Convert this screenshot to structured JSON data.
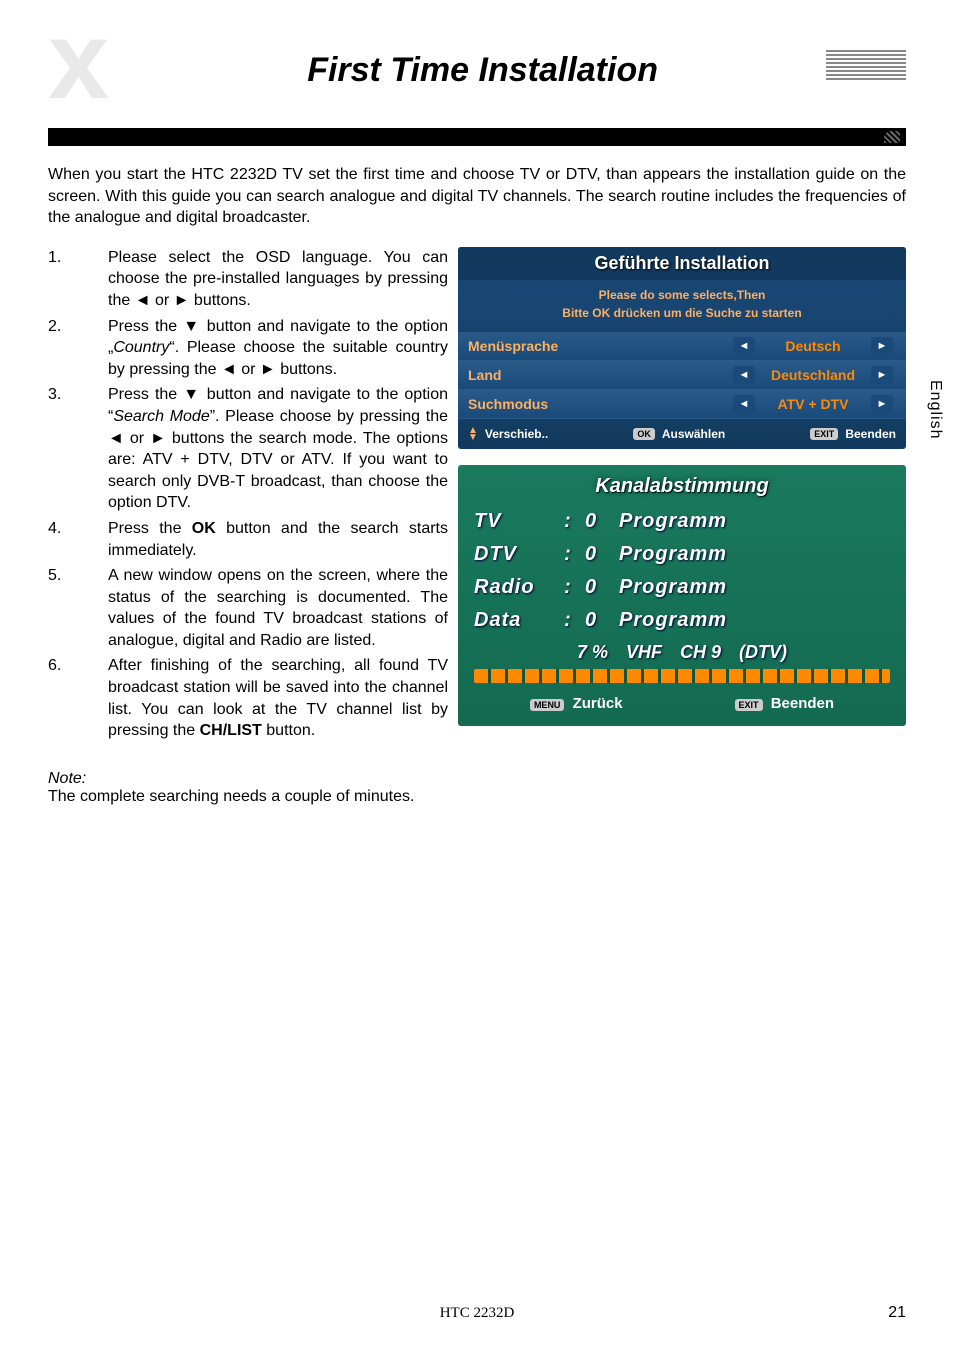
{
  "header": {
    "title": "First Time Installation",
    "logo_letter": "x"
  },
  "side_tab": "English",
  "intro": "When you start the HTC 2232D TV set the first time and choose TV or DTV, than appears the installation guide on the screen. With this guide you can search analogue and digital TV channels. The search routine includes the frequencies of the analogue and digital broadcaster.",
  "steps": [
    {
      "num": "1.",
      "text": "Please select the OSD language. You can choose the pre-installed languages by pressing the ◄ or ► buttons."
    },
    {
      "num": "2.",
      "text_html": "Press the ▼ button and navigate to the option „<i>Country</i>“. Please choose the suitable country by pressing the ◄ or ► buttons."
    },
    {
      "num": "3.",
      "text_html": "Press the ▼ button and navigate to the option “<i>Search Mode</i>”. Please choose by pressing the ◄ or ► buttons the search mode. The options are: ATV + DTV, DTV or ATV. If you want to search only DVB-T broadcast, than choose the option DTV."
    },
    {
      "num": "4.",
      "text_html": "Press the <b>OK</b> button and the search starts immediately."
    },
    {
      "num": "5.",
      "text": "A new window opens on the screen, where the status of the searching is documented. The values of the found TV broadcast stations of analogue, digital and Radio are listed."
    },
    {
      "num": "6.",
      "text_html": "After finishing of the searching, all found TV broadcast station will be saved into the channel list. You can look at the TV channel list by pressing the <b>CH/LIST</b> button."
    }
  ],
  "osd1": {
    "title": "Geführte Installation",
    "sub1": "Please do some selects,Then",
    "sub2": "Bitte OK drücken um die Suche zu starten",
    "rows": [
      {
        "label": "Menüsprache",
        "value": "Deutsch"
      },
      {
        "label": "Land",
        "value": "Deutschland"
      },
      {
        "label": "Suchmodus",
        "value": "ATV + DTV"
      }
    ],
    "footer": {
      "move": "Verschieb..",
      "ok_key": "OK",
      "ok_label": "Auswählen",
      "exit_key": "EXIT",
      "exit_label": "Beenden"
    }
  },
  "osd2": {
    "title": "Kanalabstimmung",
    "rows": [
      {
        "name": "TV",
        "count": "0",
        "label": "Programm"
      },
      {
        "name": "DTV",
        "count": "0",
        "label": "Programm"
      },
      {
        "name": "Radio",
        "count": "0",
        "label": "Programm"
      },
      {
        "name": "Data",
        "count": "0",
        "label": "Programm"
      }
    ],
    "status": {
      "percent": "7 %",
      "band": "VHF",
      "ch": "CH 9",
      "mode": "(DTV)"
    },
    "footer": {
      "menu_key": "MENU",
      "menu_label": "Zurück",
      "exit_key": "EXIT",
      "exit_label": "Beenden"
    }
  },
  "note": {
    "label": "Note:",
    "text": "The complete searching needs a couple of minutes."
  },
  "footer": {
    "model": "HTC 2232D",
    "page": "21"
  }
}
